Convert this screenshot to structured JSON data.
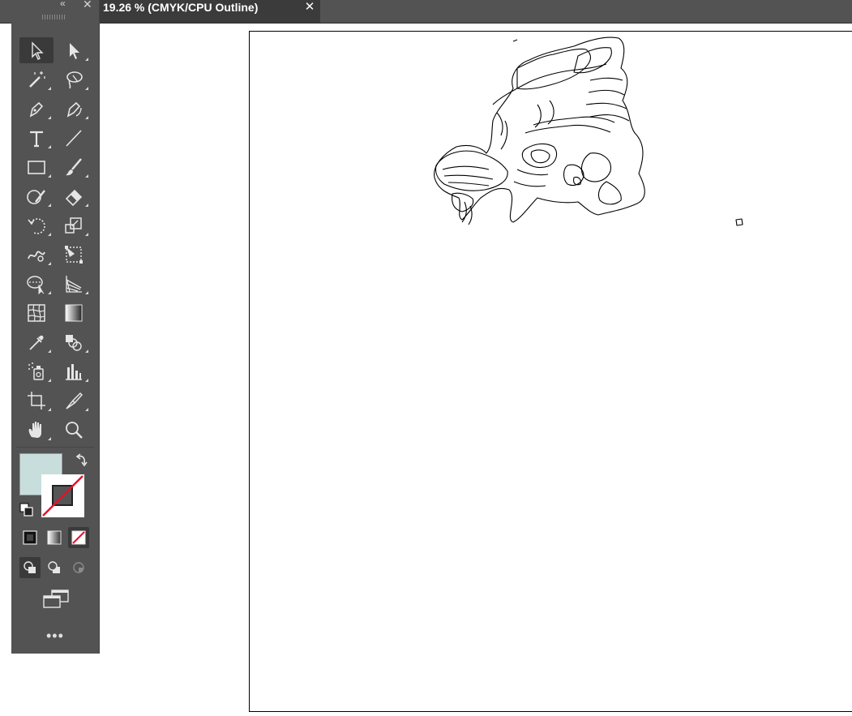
{
  "document_tab": {
    "title": "19.26 % (CMYK/CPU Outline)",
    "close_symbol": "✕"
  },
  "toolbar": {
    "collapse_symbol": "«",
    "close_symbol": "✕",
    "more_symbol": "•••",
    "tools": [
      {
        "name": "selection-tool",
        "icon": "arrow-outline-icon"
      },
      {
        "name": "direct-selection-tool",
        "icon": "arrow-filled-icon"
      },
      {
        "name": "magic-wand-tool",
        "icon": "magic-wand-icon"
      },
      {
        "name": "lasso-tool",
        "icon": "lasso-icon"
      },
      {
        "name": "pen-tool",
        "icon": "pen-icon"
      },
      {
        "name": "curvature-tool",
        "icon": "curvature-pen-icon"
      },
      {
        "name": "type-tool",
        "icon": "type-icon"
      },
      {
        "name": "line-segment-tool",
        "icon": "line-icon"
      },
      {
        "name": "rectangle-tool",
        "icon": "rectangle-icon"
      },
      {
        "name": "paintbrush-tool",
        "icon": "brush-icon"
      },
      {
        "name": "shaper-tool",
        "icon": "shaper-icon"
      },
      {
        "name": "eraser-tool",
        "icon": "eraser-icon"
      },
      {
        "name": "rotate-tool",
        "icon": "rotate-icon"
      },
      {
        "name": "scale-tool",
        "icon": "scale-icon"
      },
      {
        "name": "warp-tool",
        "icon": "warp-icon"
      },
      {
        "name": "free-transform-tool",
        "icon": "free-transform-icon"
      },
      {
        "name": "shape-builder-tool",
        "icon": "shape-builder-icon"
      },
      {
        "name": "perspective-grid-tool",
        "icon": "perspective-grid-icon"
      },
      {
        "name": "mesh-tool",
        "icon": "mesh-icon"
      },
      {
        "name": "gradient-tool",
        "icon": "gradient-icon"
      },
      {
        "name": "eyedropper-tool",
        "icon": "eyedropper-icon"
      },
      {
        "name": "blend-tool",
        "icon": "blend-icon"
      },
      {
        "name": "symbol-sprayer-tool",
        "icon": "symbol-sprayer-icon"
      },
      {
        "name": "column-graph-tool",
        "icon": "column-graph-icon"
      },
      {
        "name": "artboard-tool",
        "icon": "artboard-icon"
      },
      {
        "name": "knife-tool",
        "icon": "knife-icon"
      },
      {
        "name": "hand-tool",
        "icon": "hand-icon"
      },
      {
        "name": "zoom-tool",
        "icon": "magnifier-icon"
      }
    ],
    "colors": {
      "fill": "#c8dedd",
      "stroke_none_slash": "#e8102a",
      "panel_bg": "#535353"
    }
  }
}
